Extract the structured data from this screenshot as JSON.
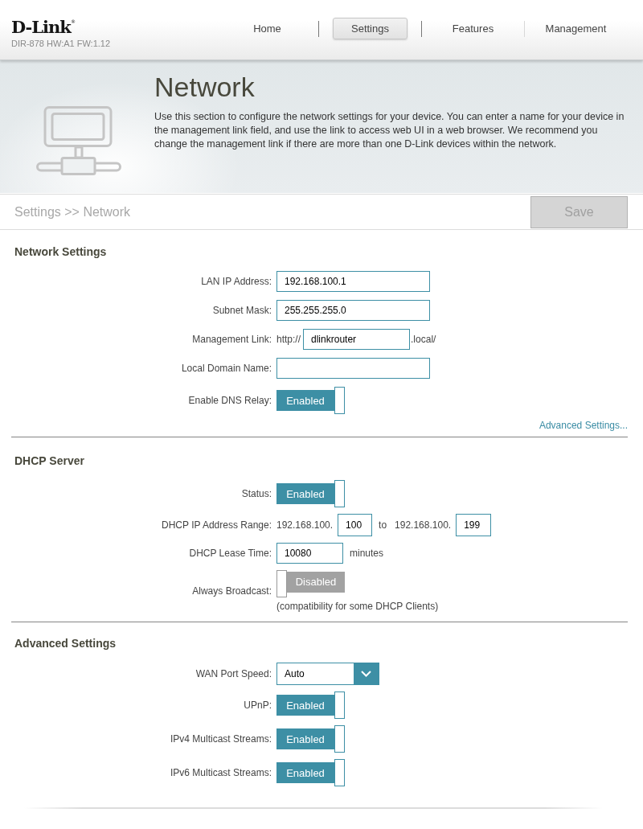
{
  "header": {
    "logo": "D-Link$^{®}$",
    "model": "DIR-878 HW:A1 FW:1.12",
    "nav": [
      {
        "label": "Home",
        "selected": false
      },
      {
        "label": "Settings",
        "selected": true
      },
      {
        "label": "Features",
        "selected": false
      },
      {
        "label": "Management",
        "selected": false
      }
    ]
  },
  "banner": {
    "title": "Network",
    "description": "Use this section to configure the network settings for your device. You can enter a name for your device in the management link field, and use the link to access web UI in a web browser. We recommend you change the management link if there are more than one D-Link devices within the network."
  },
  "breadcrumb": {
    "path": "Settings >> Network",
    "save": {
      "label": "Save",
      "disabled": true
    }
  },
  "sections": [
    {
      "title": "Network Settings",
      "rows": [
        {
          "kind": "text",
          "label": "LAN IP Address:",
          "value": "192.168.100.1"
        },
        {
          "kind": "text",
          "label": "Subnet Mask:",
          "value": "255.255.255.0"
        },
        {
          "kind": "link",
          "label": "Management Link:",
          "prefix": "http://",
          "value": "dlinkrouter",
          "suffix": ".local/"
        },
        {
          "kind": "text",
          "label": "Local Domain Name:"
        },
        {
          "kind": "toggle",
          "label": "Enable DNS Relay:",
          "on": true,
          "state_label": "Enabled"
        }
      ],
      "link": "Advanced Settings..."
    },
    {
      "title": "DHCP Server",
      "rows": [
        {
          "kind": "toggle",
          "label": "Status:",
          "on": true,
          "state_label": "Enabled"
        },
        {
          "kind": "range",
          "label": "DHCP IP Address Range:",
          "start_prefix": "192.168.100.",
          "start": "100",
          "separator": "to",
          "end_prefix": "192.168.100.",
          "end": "199"
        },
        {
          "kind": "unit",
          "label": "DHCP Lease Time:",
          "value": "10080",
          "unit": "minutes"
        },
        {
          "kind": "toggle",
          "label": "Always Broadcast:",
          "on": false,
          "state_label": "Disabled",
          "note": "(compatibility for some DHCP Clients)"
        }
      ]
    },
    {
      "title": "Advanced Settings",
      "rows": [
        {
          "kind": "select",
          "label": "WAN Port Speed:",
          "value": "Auto"
        },
        {
          "kind": "toggle",
          "label": "UPnP:",
          "on": true,
          "state_label": "Enabled"
        },
        {
          "kind": "toggle",
          "label": "IPv4 Multicast Streams:",
          "on": true,
          "state_label": "Enabled"
        },
        {
          "kind": "toggle",
          "label": "IPv6 Multicast Streams:",
          "on": true,
          "state_label": "Enabled"
        }
      ]
    }
  ]
}
